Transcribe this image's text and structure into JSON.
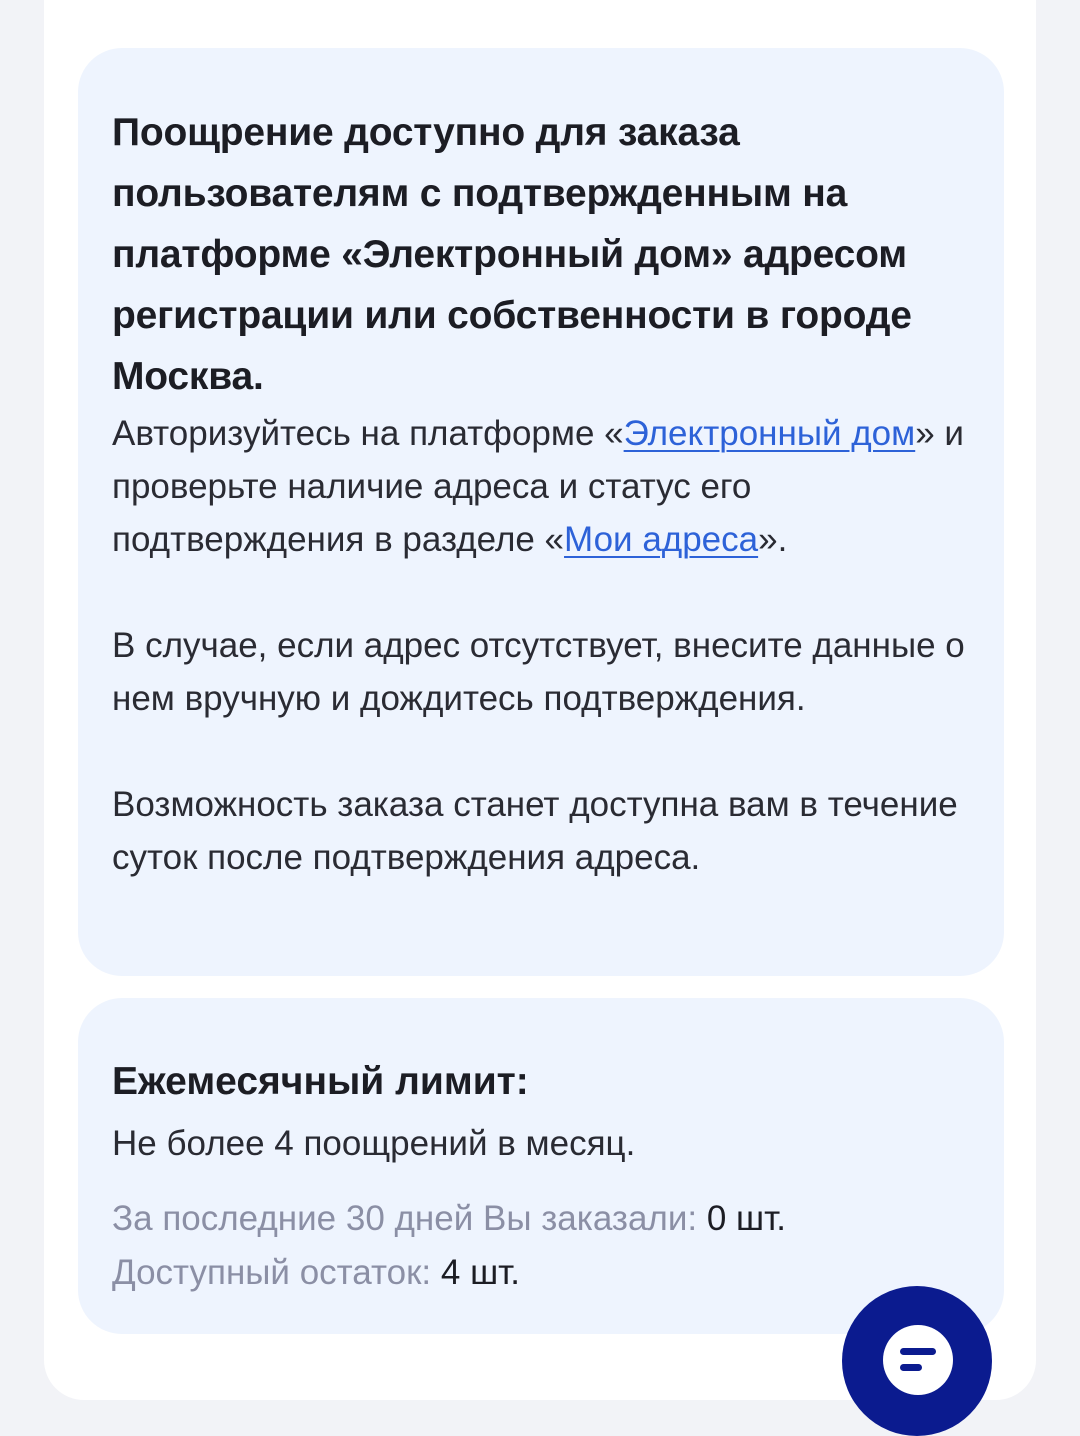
{
  "info_card": {
    "heading": "Поощрение доступно для заказа пользователям с подтвержденным на платформе «Электронный дом» адресом регистрации или собственности в городе Москва.",
    "auth_prefix": "Авторизуйтесь на платформе «",
    "auth_link_1": "Электронный дом",
    "auth_middle": "» и проверьте наличие адреса и статус его подтверждения в разделе «",
    "auth_link_2": "Мои адреса",
    "auth_suffix": "».",
    "missing_address": "В случае, если адрес отсутствует, внесите данные о нем вручную и  дождитесь подтверждения.",
    "availability": "Возможность заказа станет доступна вам в течение суток после подтверждения адреса."
  },
  "limit_card": {
    "title": "Ежемесячный лимит:",
    "description": "Не более 4 поощрений в месяц.",
    "ordered_label": "За последние 30 дней Вы заказали:",
    "ordered_value": "0 шт.",
    "remaining_label": "Доступный остаток:",
    "remaining_value": "4 шт."
  },
  "fab": {
    "icon": "menu-lines-icon",
    "colors": {
      "background": "#0b1b8f",
      "icon": "#ffffff"
    }
  },
  "colors": {
    "card_background": "#eef4fe",
    "link": "#2d62d8",
    "muted_label": "#8b8fa5",
    "text": "#1c1d24"
  }
}
